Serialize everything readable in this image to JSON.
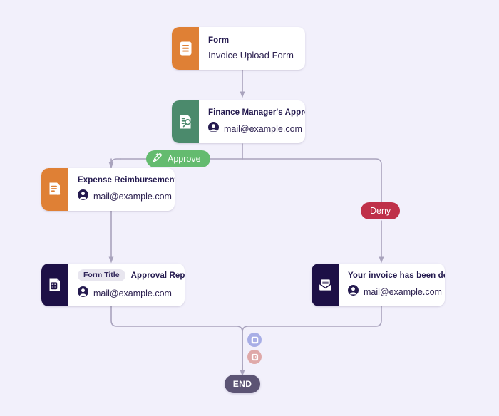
{
  "canvas": {
    "background_color": "#f2f0fb",
    "edge_color": "#a9a3bd"
  },
  "nodes": [
    {
      "id": "form",
      "icon_name": "form-document-icon",
      "icon_color": "#df8035",
      "title": "Form",
      "subtitle": "Invoice Upload Form",
      "email": null,
      "tag": null
    },
    {
      "id": "approval",
      "icon_name": "approval-signature-icon",
      "icon_color": "#4b8a6c",
      "title": "Finance Manager's Approval",
      "subtitle": null,
      "email": "mail@example.com",
      "tag": null
    },
    {
      "id": "expense",
      "icon_name": "form-forward-icon",
      "icon_color": "#df8035",
      "title": "Expense Reimbursement Form",
      "subtitle": null,
      "email": "mail@example.com",
      "tag": null
    },
    {
      "id": "report",
      "icon_name": "report-document-icon",
      "icon_color": "#1d1046",
      "title": "Approval Report",
      "subtitle": null,
      "email": "mail@example.com",
      "tag": "Form Title"
    },
    {
      "id": "denied",
      "icon_name": "email-envelope-icon",
      "icon_color": "#1d1046",
      "title": "Your invoice has been denied.",
      "subtitle": null,
      "email": "mail@example.com",
      "tag": null
    }
  ],
  "branches": {
    "approve": {
      "label": "Approve",
      "color": "#64bb6f",
      "icon_name": "signature-pen-icon"
    },
    "deny": {
      "label": "Deny",
      "color": "#bf3049"
    }
  },
  "actions": {
    "add": {
      "icon_name": "add-form-icon",
      "color": "#a8aee6"
    },
    "delete": {
      "icon_name": "trash-delete-icon",
      "color": "#dfa9a9"
    }
  },
  "end": {
    "label": "END",
    "color": "#5c5474"
  }
}
